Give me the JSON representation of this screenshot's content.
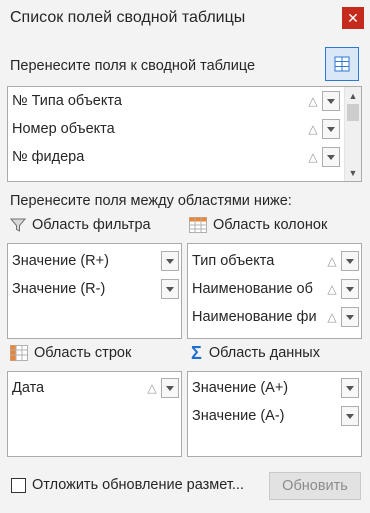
{
  "window": {
    "title": "Список полей сводной таблицы",
    "close_icon": "✕"
  },
  "fields_section": {
    "label": "Перенесите поля к сводной таблице",
    "items": [
      {
        "label": "№ Типа объекта"
      },
      {
        "label": "Номер объекта"
      },
      {
        "label": "№ фидера"
      }
    ]
  },
  "areas_label": "Перенесите поля между областями ниже:",
  "filter_area": {
    "label": "Область фильтра",
    "items": [
      {
        "label": "Значение (R+)"
      },
      {
        "label": "Значение (R-)"
      }
    ]
  },
  "columns_area": {
    "label": "Область колонок",
    "items": [
      {
        "label": "Тип объекта"
      },
      {
        "label": "Наименование об"
      },
      {
        "label": "Наименование фи"
      }
    ]
  },
  "rows_area": {
    "label": "Область строк",
    "items": [
      {
        "label": "Дата"
      }
    ]
  },
  "data_area": {
    "label": "Область данных",
    "items": [
      {
        "label": "Значение (A+)"
      },
      {
        "label": "Значение (A-)"
      }
    ]
  },
  "footer": {
    "defer_label": "Отложить обновление размет...",
    "defer_checked": false,
    "update_button": "Обновить"
  },
  "colors": {
    "accent": "#2b79d0",
    "close": "#c42b1c",
    "sigma": "#1e6fd0",
    "grid_orange": "#e8873a"
  }
}
